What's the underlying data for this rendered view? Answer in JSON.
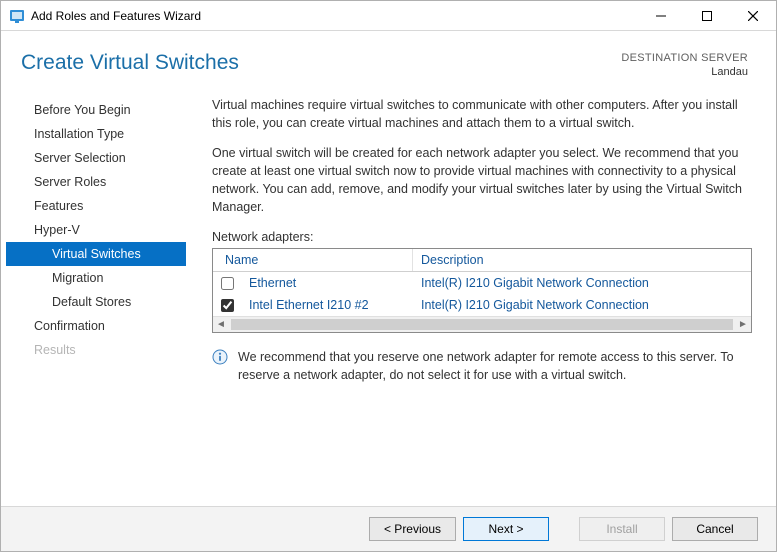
{
  "window": {
    "title": "Add Roles and Features Wizard"
  },
  "header": {
    "page_title": "Create Virtual Switches",
    "destination_label": "DESTINATION SERVER",
    "destination_host": "Landau"
  },
  "nav": {
    "items": [
      {
        "label": "Before You Begin",
        "state": "normal"
      },
      {
        "label": "Installation Type",
        "state": "normal"
      },
      {
        "label": "Server Selection",
        "state": "normal"
      },
      {
        "label": "Server Roles",
        "state": "normal"
      },
      {
        "label": "Features",
        "state": "normal"
      },
      {
        "label": "Hyper-V",
        "state": "normal"
      },
      {
        "label": "Virtual Switches",
        "state": "selected",
        "sub": true
      },
      {
        "label": "Migration",
        "state": "normal",
        "sub": true
      },
      {
        "label": "Default Stores",
        "state": "normal",
        "sub": true
      },
      {
        "label": "Confirmation",
        "state": "normal"
      },
      {
        "label": "Results",
        "state": "disabled"
      }
    ]
  },
  "content": {
    "para1": "Virtual machines require virtual switches to communicate with other computers. After you install this role, you can create virtual machines and attach them to a virtual switch.",
    "para2": "One virtual switch will be created for each network adapter you select. We recommend that you create at least one virtual switch now to provide virtual machines with connectivity to a physical network. You can add, remove, and modify your virtual switches later by using the Virtual Switch Manager.",
    "table_label": "Network adapters:",
    "columns": {
      "name": "Name",
      "description": "Description"
    },
    "rows": [
      {
        "checked": false,
        "name": "Ethernet",
        "description": "Intel(R) I210 Gigabit Network Connection"
      },
      {
        "checked": true,
        "name": "Intel Ethernet I210 #2",
        "description": "Intel(R) I210 Gigabit Network Connection"
      }
    ],
    "info_msg": "We recommend that you reserve one network adapter for remote access to this server. To reserve a network adapter, do not select it for use with a virtual switch."
  },
  "footer": {
    "previous": "< Previous",
    "next": "Next >",
    "install": "Install",
    "cancel": "Cancel"
  }
}
